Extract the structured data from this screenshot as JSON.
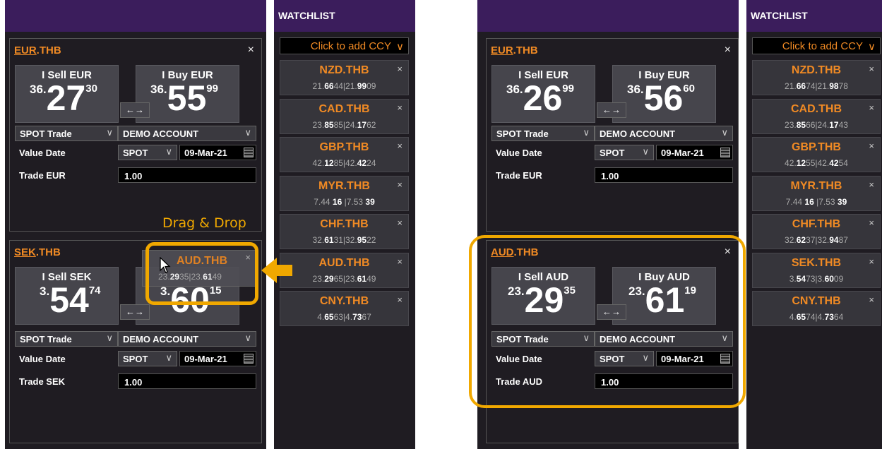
{
  "left": {
    "watchlist": {
      "header": "WATCHLIST",
      "add_label": "Click to add CCY",
      "tiles": [
        {
          "name": "NZD.THB",
          "q1": "21.",
          "q2": "66",
          "q3": "44|21.",
          "q4": "99",
          "q5": "09"
        },
        {
          "name": "CAD.THB",
          "q1": "23.",
          "q2": "85",
          "q3": "85|24.",
          "q4": "17",
          "q5": "62"
        },
        {
          "name": "GBP.THB",
          "q1": "42.",
          "q2": "12",
          "q3": "85|42.",
          "q4": "42",
          "q5": "24"
        },
        {
          "name": "MYR.THB",
          "q1": "7.44 ",
          "q2": "16",
          "q3": " |7.53 ",
          "q4": "39",
          "q5": ""
        },
        {
          "name": "CHF.THB",
          "q1": "32.",
          "q2": "61",
          "q3": "31|32.",
          "q4": "95",
          "q5": "22"
        },
        {
          "name": "AUD.THB",
          "q1": "23.",
          "q2": "29",
          "q3": "65|23.",
          "q4": "61",
          "q5": "49"
        },
        {
          "name": "CNY.THB",
          "q1": "4.",
          "q2": "65",
          "q3": "63|4.",
          "q4": "73",
          "q5": "67"
        }
      ]
    },
    "ticket1": {
      "ccy": "EUR",
      "suffix": ".THB",
      "sell_label": "I Sell EUR",
      "sell_pre": "36.",
      "sell_main": "27",
      "sell_sup": "30",
      "buy_label": "I Buy EUR",
      "buy_pre": "36.",
      "buy_main": "55",
      "buy_sup": "99",
      "trade_type": "SPOT Trade",
      "account": "DEMO ACCOUNT",
      "value_date_label": "Value Date",
      "tenor": "SPOT",
      "date": "09-Mar-21",
      "trade_label": "Trade EUR",
      "amount": "1.00"
    },
    "ticket2": {
      "ccy": "SEK",
      "suffix": ".THB",
      "sell_label": "I Sell SEK",
      "sell_pre": "3.",
      "sell_main": "54",
      "sell_sup": "74",
      "buy_pre": "3.",
      "buy_main": "60",
      "buy_sup": "15",
      "trade_type": "SPOT Trade",
      "account": "DEMO ACCOUNT",
      "value_date_label": "Value Date",
      "tenor": "SPOT",
      "date": "09-Mar-21",
      "trade_label": "Trade SEK",
      "amount": "1.00"
    },
    "drag_label": "Drag & Drop",
    "ghost": {
      "name": "AUD.THB",
      "q1": "23.",
      "q2": "29",
      "q3": "35|23.",
      "q4": "61",
      "q5": "49"
    }
  },
  "right": {
    "watchlist": {
      "header": "WATCHLIST",
      "add_label": "Click to add CCY",
      "tiles": [
        {
          "name": "NZD.THB",
          "q1": "21.",
          "q2": "66",
          "q3": "74|21.",
          "q4": "98",
          "q5": "78"
        },
        {
          "name": "CAD.THB",
          "q1": "23.",
          "q2": "85",
          "q3": "66|24.",
          "q4": "17",
          "q5": "43"
        },
        {
          "name": "GBP.THB",
          "q1": "42.",
          "q2": "12",
          "q3": "55|42.",
          "q4": "42",
          "q5": "54"
        },
        {
          "name": "MYR.THB",
          "q1": "7.44 ",
          "q2": "16",
          "q3": " |7.53 ",
          "q4": "39",
          "q5": ""
        },
        {
          "name": "CHF.THB",
          "q1": "32.",
          "q2": "62",
          "q3": "37|32.",
          "q4": "94",
          "q5": "87"
        },
        {
          "name": "SEK.THB",
          "q1": "3.",
          "q2": "54",
          "q3": "73|3.",
          "q4": "60",
          "q5": "09"
        },
        {
          "name": "CNY.THB",
          "q1": "4.",
          "q2": "65",
          "q3": "74|4.",
          "q4": "73",
          "q5": "64"
        }
      ]
    },
    "ticket1": {
      "ccy": "EUR",
      "suffix": ".THB",
      "sell_label": "I Sell EUR",
      "sell_pre": "36.",
      "sell_main": "26",
      "sell_sup": "99",
      "buy_label": "I Buy EUR",
      "buy_pre": "36.",
      "buy_main": "56",
      "buy_sup": "60",
      "trade_type": "SPOT Trade",
      "account": "DEMO ACCOUNT",
      "value_date_label": "Value Date",
      "tenor": "SPOT",
      "date": "09-Mar-21",
      "trade_label": "Trade EUR",
      "amount": "1.00"
    },
    "ticket2": {
      "ccy": "AUD",
      "suffix": ".THB",
      "sell_label": "I Sell AUD",
      "sell_pre": "23.",
      "sell_main": "29",
      "sell_sup": "35",
      "buy_label": "I Buy AUD",
      "buy_pre": "23.",
      "buy_main": "61",
      "buy_sup": "19",
      "trade_type": "SPOT Trade",
      "account": "DEMO ACCOUNT",
      "value_date_label": "Value Date",
      "tenor": "SPOT",
      "date": "09-Mar-21",
      "trade_label": "Trade AUD",
      "amount": "1.00"
    }
  },
  "icons": {
    "close": "×",
    "swap": "←→",
    "chevron": "∨"
  },
  "colors": {
    "accent": "#f08a24",
    "header": "#3b1d5c",
    "highlight": "#f0a800",
    "panel": "#1f1c22"
  }
}
